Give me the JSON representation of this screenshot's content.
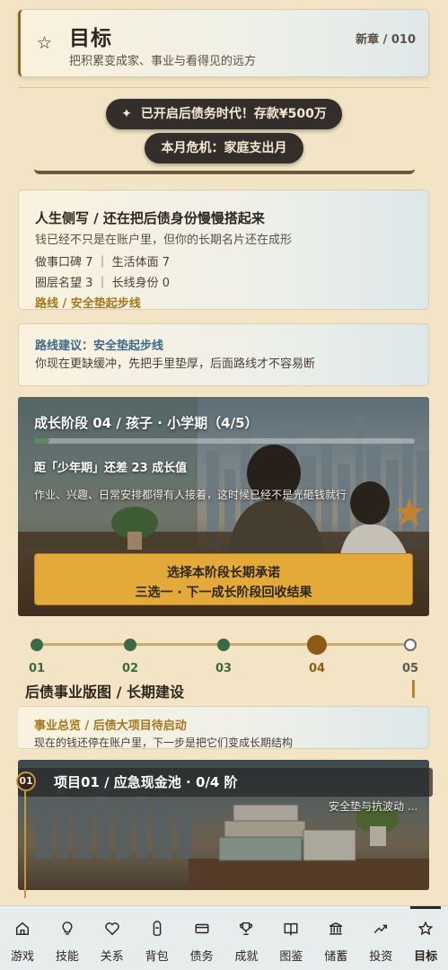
{
  "header": {
    "title": "目标",
    "subtitle": "把积累变成家、事业与看得见的远方",
    "chapter": "新章 / 010"
  },
  "banners": {
    "debt_era": "已开启后债务时代！存款¥500万",
    "monthly_crisis": "本月危机：家庭支出月"
  },
  "life_card": {
    "title": "人生侧写 / 还在把后债身份慢慢搭起来",
    "desc": "钱已经不只是在账户里，但你的长期名片还在成形",
    "row1": "做事口碑 7 ｜ 生活体面 7",
    "row2": "圈层名望 3 ｜ 长线身份 0",
    "route": "路线 / 安全垫起步线"
  },
  "route_card": {
    "title": "路线建议：安全垫起步线",
    "desc": "你现在更缺缓冲，先把手里垫厚，后面路线才不容易断"
  },
  "growth_stage": {
    "title": "成长阶段 04 / 孩子 · 小学期（4/5）",
    "progress": 0.04,
    "need": "距「少年期」还差 23 成长值",
    "desc": "作业、兴趣、日常安排都得有人接着，这时候已经不是光砸钱就行",
    "cta_line1": "选择本阶段长期承诺",
    "cta_line2": "三选一 · 下一成长阶段回收结果"
  },
  "timeline": {
    "labels": [
      "01",
      "02",
      "03",
      "04",
      "05"
    ],
    "current_index": 3
  },
  "section": {
    "title": "后债事业版图 / 长期建设"
  },
  "business_card": {
    "title": "事业总览 / 后债大项目待启动",
    "desc": "现在的钱还停在账户里，下一步是把它们变成长期结构"
  },
  "project": {
    "number": "01",
    "title": "项目01 / 应急现金池 · 0/4 阶",
    "tag": "安全垫与抗波动 ..."
  },
  "nav": {
    "items": [
      {
        "label": "游戏",
        "icon": "home-icon"
      },
      {
        "label": "技能",
        "icon": "lightbulb-icon"
      },
      {
        "label": "关系",
        "icon": "heart-icon"
      },
      {
        "label": "背包",
        "icon": "bag-icon"
      },
      {
        "label": "债务",
        "icon": "card-icon"
      },
      {
        "label": "成就",
        "icon": "trophy-icon"
      },
      {
        "label": "图鉴",
        "icon": "book-icon"
      },
      {
        "label": "储蓄",
        "icon": "bank-icon"
      },
      {
        "label": "投资",
        "icon": "trend-icon"
      },
      {
        "label": "目标",
        "icon": "star-icon"
      }
    ],
    "active_index": 9
  },
  "colors": {
    "background": "#f2e4c4",
    "accent_gold": "#e3aa3a",
    "accent_brown": "#8b5a16",
    "done_green": "#3b6a44",
    "route_blue": "#3f6a86"
  }
}
